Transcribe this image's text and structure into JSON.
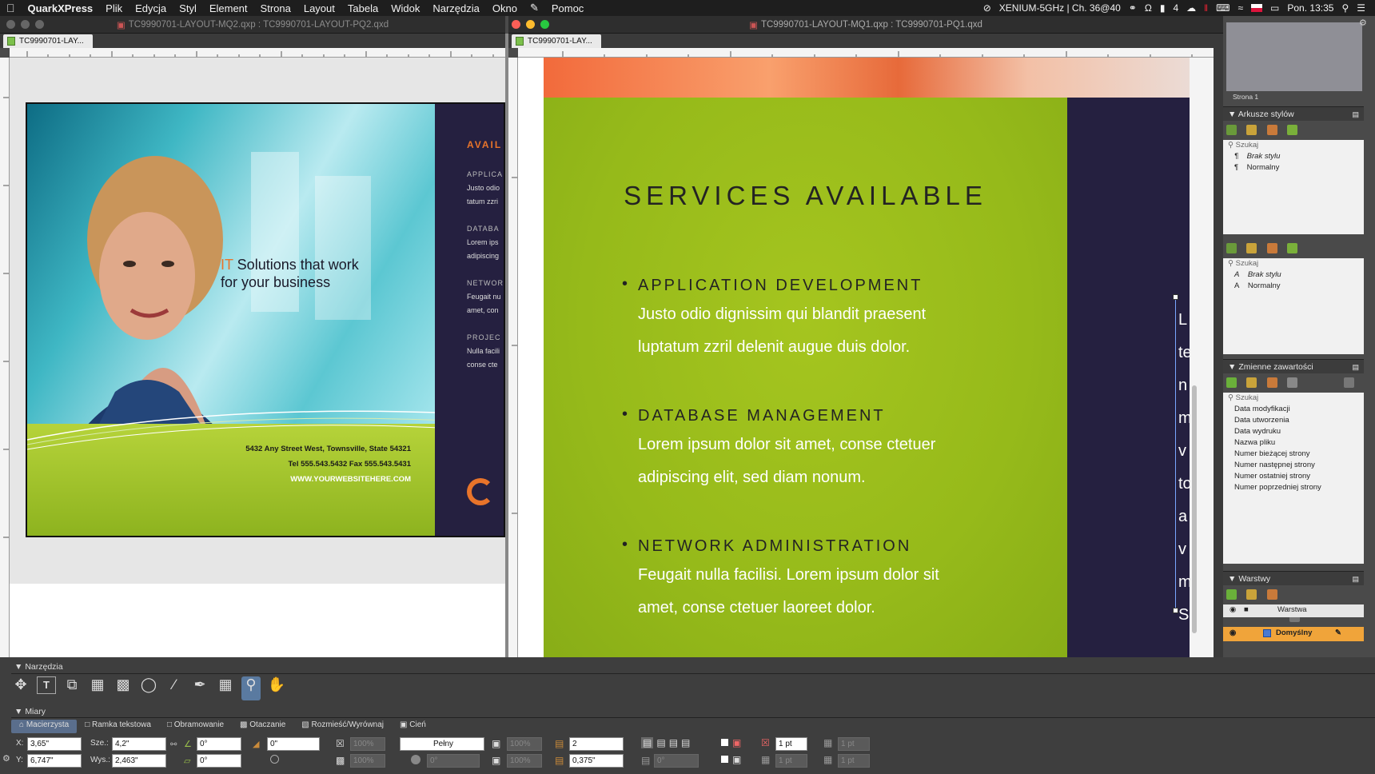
{
  "menubar": {
    "app": "QuarkXPress",
    "items": [
      "Plik",
      "Edycja",
      "Styl",
      "Element",
      "Strona",
      "Layout",
      "Tabela",
      "Widok",
      "Narzędzia",
      "Okno",
      "Pomoc"
    ],
    "wifi_label": "XENIUM-5GHz | Ch. 36@40",
    "battery_count": "4",
    "clock": "Pon. 13:35"
  },
  "left_window": {
    "title": "TC9990701-LAYOUT-MQ2.qxp : TC9990701-LAYOUT-PQ2.qxd",
    "tab": "TC9990701-LAY...",
    "ad": {
      "headline_accent": "IT",
      "headline_rest": " Solutions that work",
      "headline_line2": "for your business",
      "address": "5432 Any Street West, Townsville, State 54321",
      "phone": "Tel 555.543.5432   Fax 555.543.5431",
      "website": "WWW.YOURWEBSITEHERE.COM",
      "side_title": "AVAIL",
      "side_items": [
        {
          "head": "APPLICA",
          "l1": "Justo odio",
          "l2": "tatum zzri"
        },
        {
          "head": "DATABA",
          "l1": "Lorem ips",
          "l2": "adipiscing"
        },
        {
          "head": "NETWOR",
          "l1": "Feugait nu",
          "l2": "amet, con"
        },
        {
          "head": "PROJEC",
          "l1": "Nulla facili",
          "l2": "conse cte"
        }
      ]
    }
  },
  "right_window": {
    "title": "TC9990701-LAYOUT-MQ1.qxp : TC9990701-PQ1.qxd",
    "tab": "TC9990701-LAY...",
    "services_title": "SERVICES AVAILABLE",
    "services": [
      {
        "head": "APPLICATION DEVELOPMENT",
        "l1": "Justo odio dignissim qui blandit praesent",
        "l2": "luptatum zzril delenit augue duis dolor."
      },
      {
        "head": "DATABASE MANAGEMENT",
        "l1": "Lorem ipsum dolor sit amet, conse ctetuer",
        "l2": "adipiscing elit, sed diam nonum."
      },
      {
        "head": "NETWORK ADMINISTRATION",
        "l1": "Feugait nulla facilisi. Lorem ipsum dolor sit",
        "l2": "amet, conse ctetuer laoreet dolor."
      }
    ],
    "side_letters": [
      "L",
      "te",
      "n",
      "m",
      "v",
      "to",
      "a",
      "v",
      "m",
      "S"
    ]
  },
  "palettes": {
    "page_label": "Strona 1",
    "style_sheets": {
      "title": "Arkusze stylów",
      "search": "Szukaj",
      "paragraph": [
        "Brak stylu",
        "Normalny"
      ],
      "character": [
        "Brak stylu",
        "Normalny"
      ]
    },
    "content_variables": {
      "title": "Zmienne zawartości",
      "search": "Szukaj",
      "items": [
        "Data modyfikacji",
        "Data utworzenia",
        "Data wydruku",
        "Nazwa pliku",
        "Numer bieżącej strony",
        "Numer następnej strony",
        "Numer ostatniej strony",
        "Numer poprzedniej strony"
      ]
    },
    "layers": {
      "title": "Warstwy",
      "column": "Warstwa",
      "default_layer": "Domyślny"
    }
  },
  "tools_palette": {
    "title": "Narzędzia"
  },
  "measurements": {
    "title": "Miary",
    "tabs": [
      "Macierzysta",
      "Ramka tekstowa",
      "Obramowanie",
      "Otaczanie",
      "Rozmieść/Wyrównaj",
      "Cień"
    ],
    "x_label": "X:",
    "x": "3,65\"",
    "y_label": "Y:",
    "y": "6,747\"",
    "w_label": "Sze.:",
    "w": "4,2\"",
    "h_label": "Wys.:",
    "h": "2,463\"",
    "angle": "0°",
    "skew": "0°",
    "corner": "0\"",
    "scale_x": "100%",
    "scale_y": "100%",
    "fill_style": "Pełny",
    "opacity": "100%",
    "opacity2": "100%",
    "columns": "2",
    "gutter": "0,375\"",
    "angle2": "0°",
    "angle3": "0°",
    "stroke": "1 pt",
    "stroke2": "1 pt",
    "stroke3": "1 pt",
    "stroke4": "1 pt"
  },
  "colors": {
    "accent_orange": "#e8742a",
    "lime": "#9fc41c",
    "navy": "#252040",
    "layer_highlight": "#f0a43a"
  }
}
